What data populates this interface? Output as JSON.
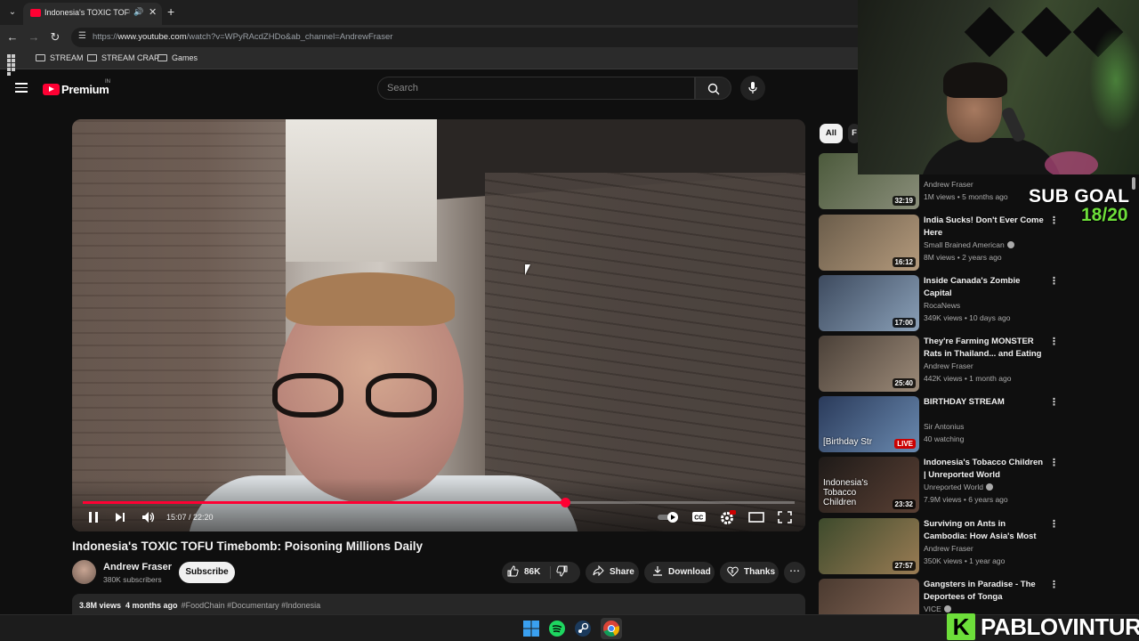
{
  "browser": {
    "tab_title": "Indonesia's TOXIC TOFU Tim",
    "tab_dropdown_icon": "chevron-down-icon",
    "url_prefix": "https://",
    "url_domain": "www.youtube.com",
    "url_path": "/watch?v=WPyRAcdZHDo&ab_channel=AndrewFraser",
    "bookmarks": [
      {
        "label": "STREAM"
      },
      {
        "label": "STREAM CRAP"
      },
      {
        "label": "Games"
      }
    ]
  },
  "youtube": {
    "logo_text": "Premium",
    "logo_sup": "IN",
    "search_placeholder": "Search"
  },
  "player": {
    "current_time": "15:07",
    "duration": "22:20",
    "time_display": "15:07 / 22:20",
    "progress": 0.677,
    "accent": "#ff0033"
  },
  "video": {
    "title": "Indonesia's TOXIC TOFU Timebomb: Poisoning Millions Daily",
    "channel": "Andrew Fraser",
    "subscribers": "380K subscribers",
    "subscribe_label": "Subscribe",
    "likes": "86K",
    "share_label": "Share",
    "download_label": "Download",
    "thanks_label": "Thanks",
    "views": "3.8M views",
    "age": "4 months ago",
    "tags": "#FoodChain #Documentary #Indonesia"
  },
  "chips": [
    {
      "label": "All"
    },
    {
      "label": "F"
    }
  ],
  "recommendations": [
    {
      "title": "",
      "channel": "Andrew Fraser",
      "verified": false,
      "meta": "1M views • 5 months ago",
      "duration": "32:19",
      "live": false
    },
    {
      "title": "India Sucks! Don't Ever Come Here",
      "channel": "Small Brained American",
      "verified": true,
      "meta": "8M views • 2 years ago",
      "duration": "16:12",
      "live": false
    },
    {
      "title": "Inside Canada's Zombie Capital",
      "channel": "RocaNews",
      "verified": false,
      "meta": "349K views • 10 days ago",
      "duration": "17:00",
      "live": false
    },
    {
      "title": "They're Farming MONSTER Rats in Thailand... and Eating Them",
      "channel": "Andrew Fraser",
      "verified": false,
      "meta": "442K views • 1 month ago",
      "duration": "25:40",
      "live": false
    },
    {
      "title": "BIRTHDAY STREAM",
      "channel": "Sir Antonius",
      "verified": false,
      "meta": "40 watching",
      "duration": "LIVE",
      "live": true,
      "thumb_text": "[Birthday Str"
    },
    {
      "title": "Indonesia's Tobacco Children | Unreported World",
      "channel": "Unreported World",
      "verified": true,
      "meta": "7.9M views • 6 years ago",
      "duration": "23:32",
      "live": false,
      "thumb_text": "Indonesia's Tobacco Children"
    },
    {
      "title": "Surviving on Ants in Cambodia: How Asia's Most Painful Dish i...",
      "channel": "Andrew Fraser",
      "verified": false,
      "meta": "350K views • 1 year ago",
      "duration": "27:57",
      "live": false
    },
    {
      "title": "Gangsters in Paradise - The Deportees of Tonga",
      "channel": "VICE",
      "verified": true,
      "meta": "",
      "duration": "",
      "live": false
    }
  ],
  "overlay": {
    "sub_goal_label": "SUB GOAL",
    "sub_goal_count": "18/20",
    "brand_letter": "K",
    "brand_name": "PABLOVINTURA"
  }
}
